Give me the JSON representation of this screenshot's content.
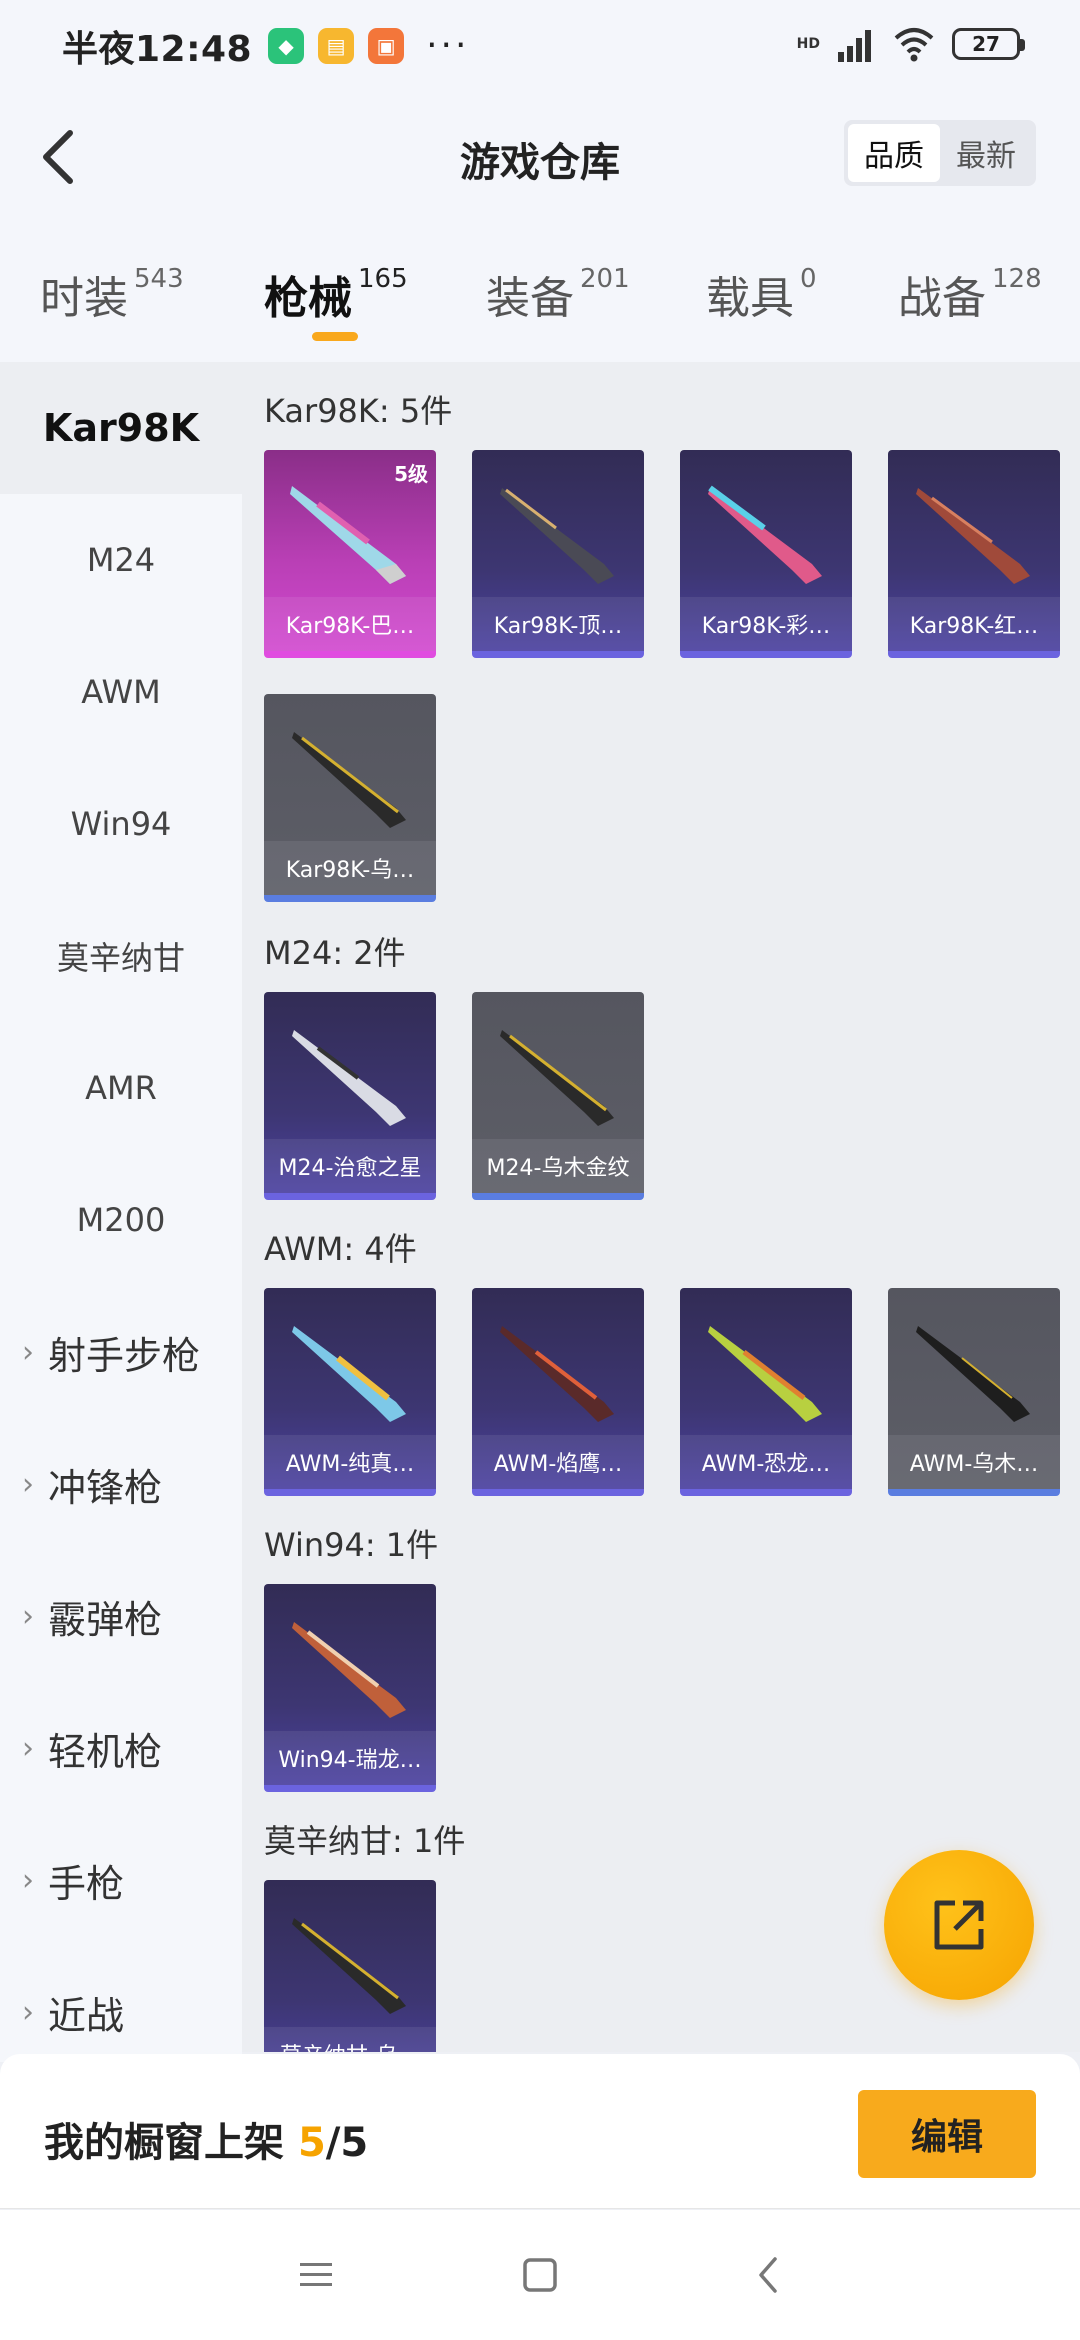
{
  "status_bar": {
    "time": "半夜12:48",
    "more": "···",
    "signal_tag": "HD",
    "battery": "27"
  },
  "header": {
    "title": "游戏仓库",
    "sort_options": [
      "品质",
      "最新"
    ]
  },
  "tabs": [
    {
      "label": "时装",
      "count": "543"
    },
    {
      "label": "枪械",
      "count": "165"
    },
    {
      "label": "装备",
      "count": "201"
    },
    {
      "label": "载具",
      "count": "0"
    },
    {
      "label": "战备",
      "count": "128"
    }
  ],
  "sidebar": {
    "items": [
      "Kar98K",
      "M24",
      "AWM",
      "Win94",
      "莫辛纳甘",
      "AMR",
      "M200"
    ],
    "groups": [
      "射手步枪",
      "冲锋枪",
      "霰弹枪",
      "轻机枪",
      "手枪",
      "近战"
    ]
  },
  "sections": [
    {
      "title": "Kar98K: 5件",
      "items": [
        {
          "label": "Kar98K-巴…",
          "level": "5级"
        },
        {
          "label": "Kar98K-顶…"
        },
        {
          "label": "Kar98K-彩…"
        },
        {
          "label": "Kar98K-红…"
        },
        {
          "label": "Kar98K-乌…"
        }
      ]
    },
    {
      "title": "M24: 2件",
      "items": [
        {
          "label": "M24-治愈之星"
        },
        {
          "label": "M24-乌木金纹"
        }
      ]
    },
    {
      "title": "AWM: 4件",
      "items": [
        {
          "label": "AWM-纯真…"
        },
        {
          "label": "AWM-焰鹰…"
        },
        {
          "label": "AWM-恐龙…"
        },
        {
          "label": "AWM-乌木…"
        }
      ]
    },
    {
      "title": "Win94: 1件",
      "items": [
        {
          "label": "Win94-瑞龙…"
        }
      ]
    },
    {
      "title": "莫辛纳甘: 1件",
      "items": [
        {
          "label": "莫辛纳甘-乌…"
        }
      ]
    }
  ],
  "bottom": {
    "prefix": "我的橱窗上架 ",
    "count": "5",
    "suffix": "/5",
    "edit_label": "编辑"
  },
  "icons": {
    "back": "back-chevron-icon",
    "fab": "share-export-icon",
    "nav": [
      "menu-icon",
      "home-icon",
      "back-icon"
    ]
  },
  "colors": {
    "accent": "#f6a300",
    "card_purple": "#3d3672",
    "card_pink": "#c045c0",
    "card_gray": "#5a5b64"
  }
}
